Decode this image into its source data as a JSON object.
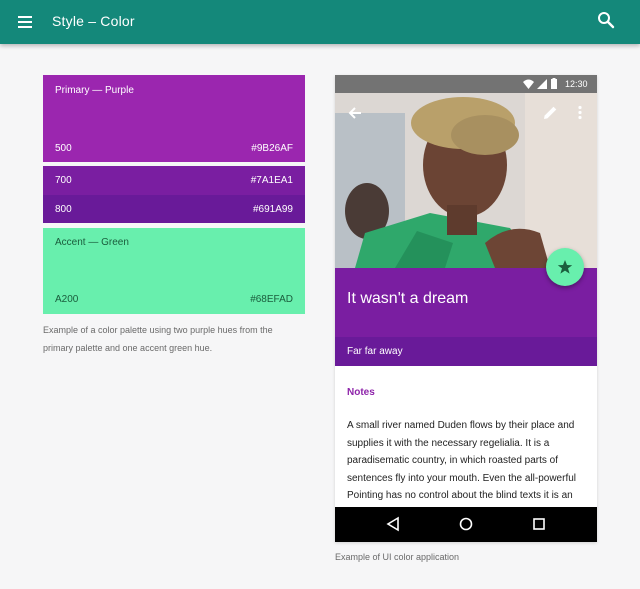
{
  "appbar": {
    "title": "Style  –  Color",
    "icons": {
      "menu": "menu-icon",
      "search": "search-icon"
    },
    "color": "#14887a"
  },
  "palette": {
    "primary": {
      "name": "Primary — Purple",
      "shade": "500",
      "hex": "#9B26AF",
      "color": "#9b26af"
    },
    "p700": {
      "shade": "700",
      "hex": "#7A1EA1",
      "color": "#7a1ea1"
    },
    "p800": {
      "shade": "800",
      "hex": "#691A99",
      "color": "#691a99"
    },
    "accent": {
      "name": "Accent — Green",
      "shade": "A200",
      "hex": "#68EFAD",
      "color": "#68efad"
    },
    "caption_line1": "Example of a color palette using two purple hues from the",
    "caption_line2": "primary palette and one accent green hue."
  },
  "phone": {
    "status_time": "12:30",
    "status_icons": [
      "wifi-icon",
      "signal-icon",
      "battery-icon"
    ],
    "toolbar_icons": [
      "back-arrow-icon",
      "edit-pencil-icon",
      "more-vert-icon"
    ],
    "headline": "It wasn't a dream",
    "subheadline": "Far far away",
    "fab_icon": "star-icon",
    "notes_label": "Notes",
    "body_lines": [
      "A small river named Duden flows by their place and",
      "supplies it with the necessary regelialia. It is a",
      "paradisematic country, in which roasted parts of",
      "sentences fly into your mouth. Even the all-powerful",
      "Pointing has no control about the blind texts it is an"
    ],
    "nav_icons": [
      "nav-back-icon",
      "nav-home-icon",
      "nav-recents-icon"
    ],
    "caption": "Example of UI color application"
  }
}
